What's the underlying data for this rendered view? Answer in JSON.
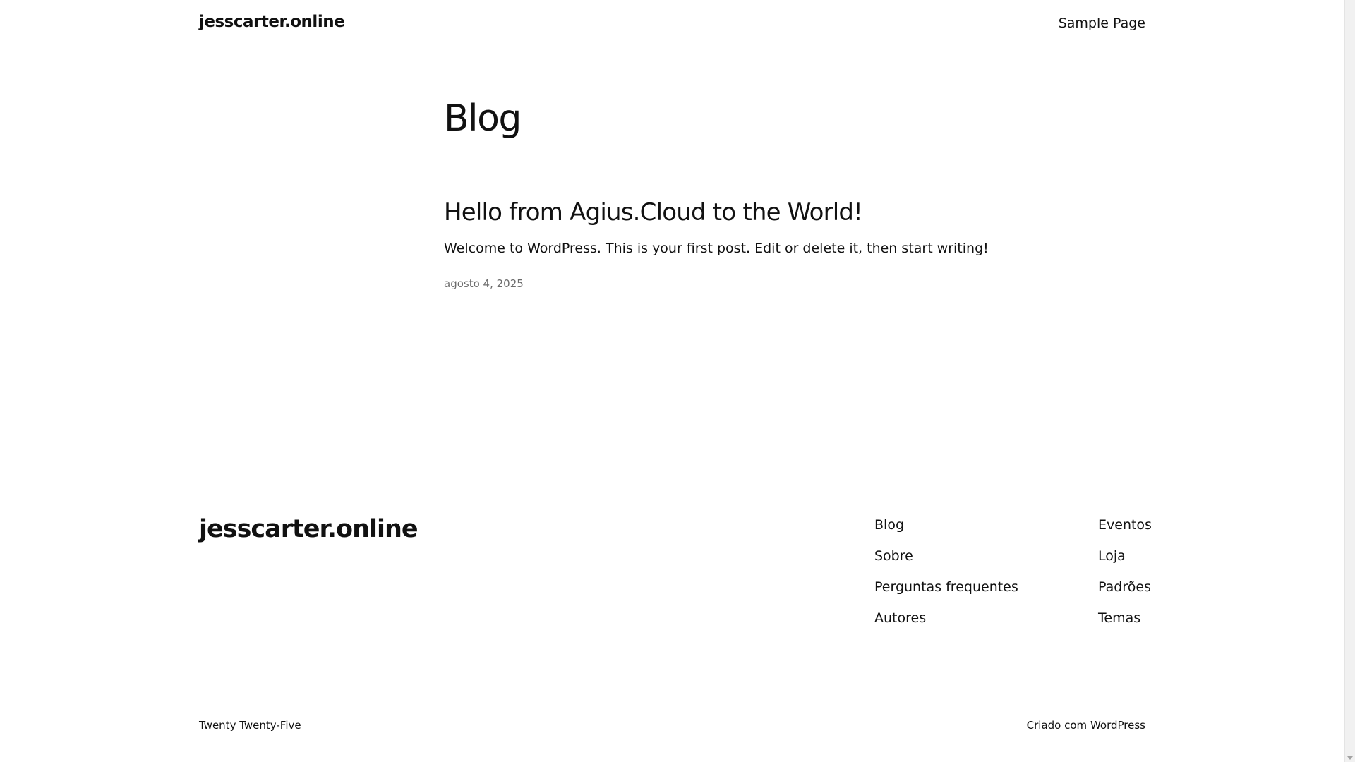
{
  "header": {
    "site_title": "jesscarter.online",
    "nav": [
      "Sample Page"
    ]
  },
  "main": {
    "heading": "Blog",
    "posts": [
      {
        "title": "Hello from Agius.Cloud to the World!",
        "excerpt": "Welcome to WordPress. This is your first post. Edit or delete it, then start writing!",
        "date": "agosto 4, 2025"
      }
    ]
  },
  "footer": {
    "site_title": "jesscarter.online",
    "nav_col1": [
      "Blog",
      "Sobre",
      "Perguntas frequentes",
      "Autores"
    ],
    "nav_col2": [
      "Eventos",
      "Loja",
      "Padrões",
      "Temas"
    ],
    "theme_credit": "Twenty Twenty-Five",
    "powered_prefix": "Criado com",
    "powered_link": "WordPress"
  }
}
